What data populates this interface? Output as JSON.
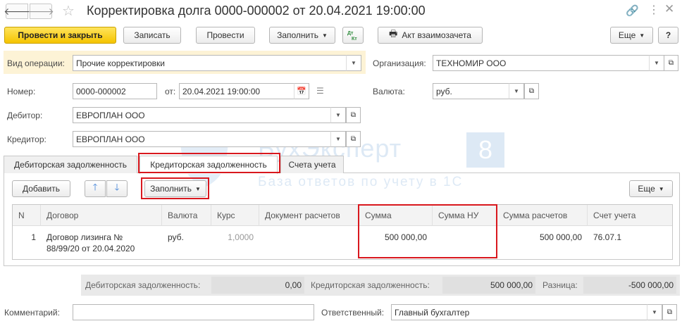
{
  "window": {
    "title": "Корректировка долга 0000-000002 от 20.04.2021 19:00:00"
  },
  "toolbar": {
    "post_close": "Провести и закрыть",
    "save": "Записать",
    "post": "Провести",
    "fill": "Заполнить",
    "dtkt": "Дт Кт",
    "act": "Акт взаимозачета",
    "more": "Еще",
    "help": "?"
  },
  "form": {
    "op_label": "Вид операции:",
    "op_value": "Прочие корректировки",
    "org_label": "Организация:",
    "org_value": "ТЕХНОМИР ООО",
    "num_label": "Номер:",
    "num_value": "0000-000002",
    "date_label": "от:",
    "date_value": "20.04.2021 19:00:00",
    "currency_label": "Валюта:",
    "currency_value": "руб.",
    "debtor_label": "Дебитор:",
    "debtor_value": "ЕВРОПЛАН ООО",
    "creditor_label": "Кредитор:",
    "creditor_value": "ЕВРОПЛАН ООО"
  },
  "tabs": [
    {
      "label": "Дебиторская задолженность",
      "active": false
    },
    {
      "label": "Кредиторская задолженность",
      "active": true
    },
    {
      "label": "Счета учета",
      "active": false
    }
  ],
  "table_toolbar": {
    "add": "Добавить",
    "fill": "Заполнить",
    "more": "Еще"
  },
  "table": {
    "columns": [
      "N",
      "Договор",
      "Валюта",
      "Курс",
      "Документ расчетов",
      "Сумма",
      "Сумма НУ",
      "Сумма расчетов",
      "Счет учета"
    ],
    "rows": [
      {
        "n": "1",
        "contract_line1": "Договор лизинга №",
        "contract_line2": "88/99/20 от 20.04.2020",
        "currency": "руб.",
        "rate": "1,0000",
        "doc": "",
        "sum": "500 000,00",
        "sum_nu": "",
        "sum_settle": "500 000,00",
        "account": "76.07.1"
      }
    ]
  },
  "totals": {
    "debt_label": "Дебиторская задолженность:",
    "debt_value": "0,00",
    "cred_label": "Кредиторская задолженность:",
    "cred_value": "500 000,00",
    "diff_label": "Разница:",
    "diff_value": "-500 000,00"
  },
  "footer": {
    "comment_label": "Комментарий:",
    "comment_value": "",
    "resp_label": "Ответственный:",
    "resp_value": "Главный бухгалтер"
  },
  "watermark": {
    "line1": "БухЭксперт",
    "badge": "8",
    "line2": "База ответов по учету в 1С"
  },
  "colors": {
    "highlight_red": "#d9181e",
    "primary_yellow": "#f5c400",
    "op_row_bg": "#fdf3d6",
    "totals_bg": "#e9e9e9"
  }
}
